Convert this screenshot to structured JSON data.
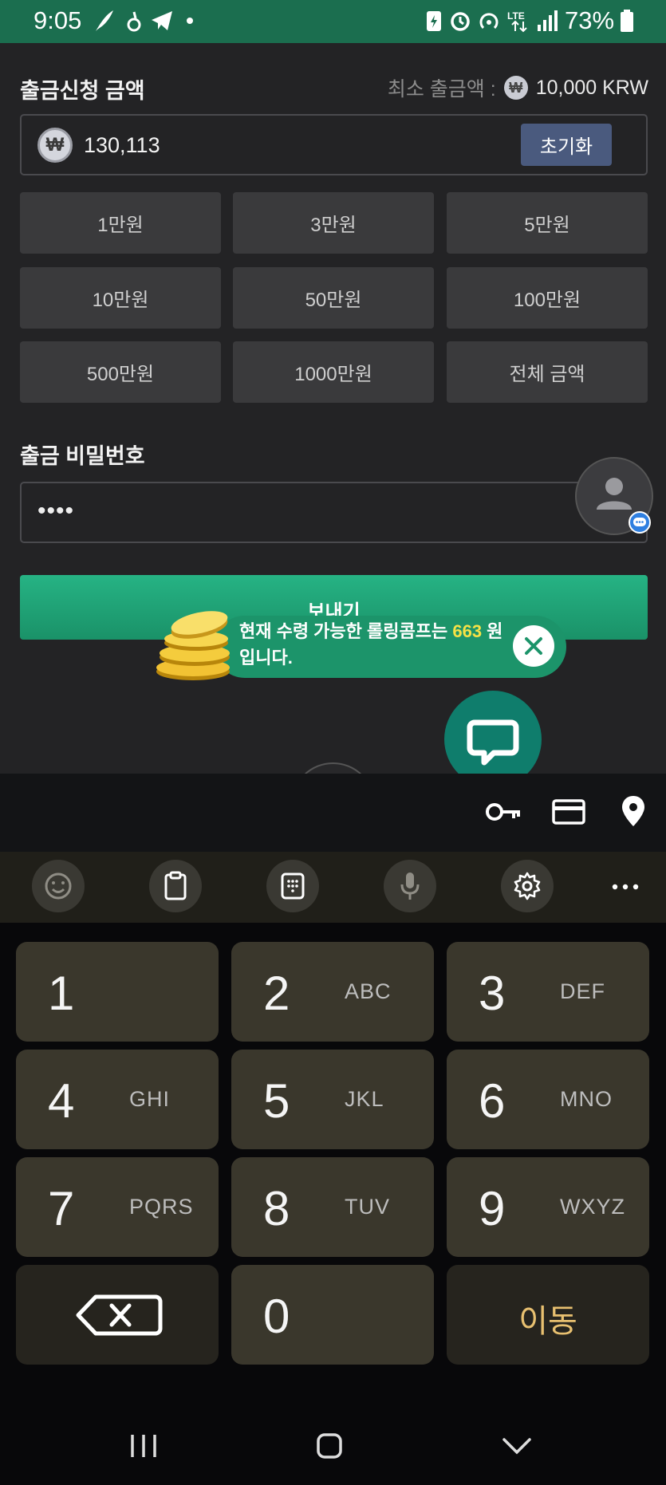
{
  "status_bar": {
    "time": "9:05",
    "battery": "73%"
  },
  "withdraw": {
    "title": "출금신청 금액",
    "min_label": "최소 출금액 :",
    "min_currency_symbol": "₩",
    "min_value": "10,000 KRW",
    "currency_symbol": "₩",
    "amount_value": "130,113",
    "reset_label": "초기화",
    "amount_buttons": [
      "1만원",
      "3만원",
      "5만원",
      "10만원",
      "50만원",
      "100만원",
      "500만원",
      "1000만원",
      "전체 금액"
    ]
  },
  "password": {
    "title": "출금 비밀번호",
    "value": "••••"
  },
  "send_label": "보내기",
  "toast": {
    "text_before": "현재 수령 가능한 롤링콤프는 ",
    "highlight": "663",
    "text_after": " 원 입니다."
  },
  "keyboard": {
    "keys": [
      {
        "num": "1",
        "letters": ""
      },
      {
        "num": "2",
        "letters": "ABC"
      },
      {
        "num": "3",
        "letters": "DEF"
      },
      {
        "num": "4",
        "letters": "GHI"
      },
      {
        "num": "5",
        "letters": "JKL"
      },
      {
        "num": "6",
        "letters": "MNO"
      },
      {
        "num": "7",
        "letters": "PQRS"
      },
      {
        "num": "8",
        "letters": "TUV"
      },
      {
        "num": "9",
        "letters": "WXYZ"
      },
      {
        "num": "0",
        "letters": ""
      }
    ],
    "go_label": "이동"
  },
  "colors": {
    "accent_green": "#1b6e4f",
    "send_green": "#1fa575",
    "highlight_yellow": "#f6e246",
    "go_key_text": "#e8c070"
  }
}
